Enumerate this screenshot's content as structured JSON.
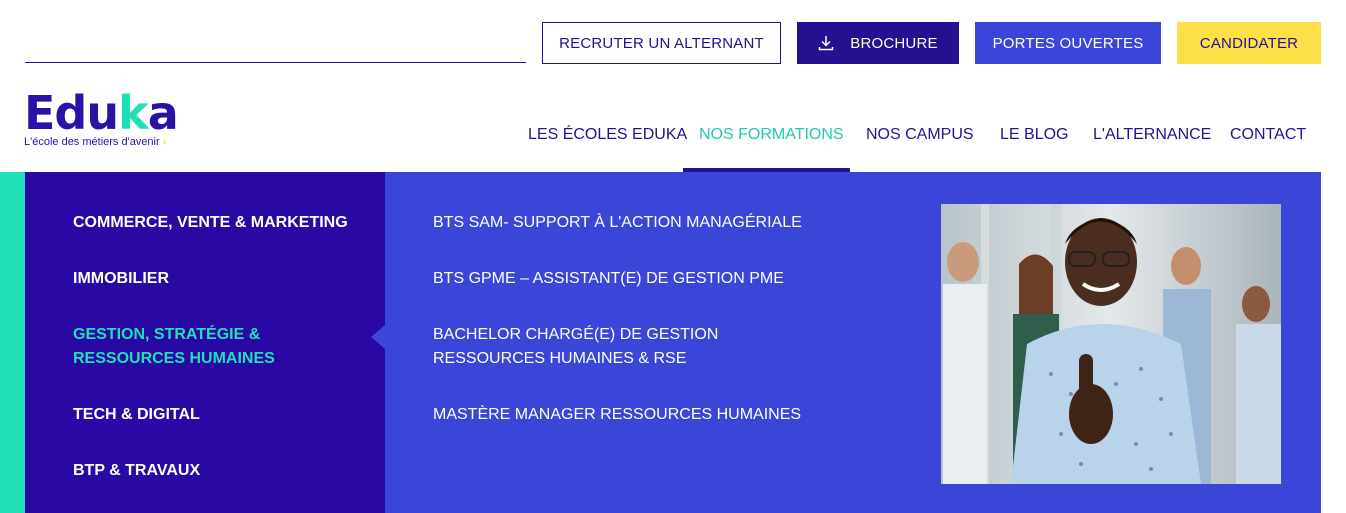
{
  "header": {
    "buttons": {
      "recruter": "RECRUTER UN ALTERNANT",
      "brochure": "BROCHURE",
      "portes": "PORTES OUVERTES",
      "candidater": "CANDIDATER"
    }
  },
  "logo": {
    "word_main": "Edu",
    "word_k": "k",
    "word_end": "a",
    "tagline": "L'école des métiers d'avenir",
    "tagline_chevron": "›"
  },
  "nav": {
    "items": [
      {
        "label": "LES ÉCOLES EDUKA"
      },
      {
        "label": "NOS FORMATIONS"
      },
      {
        "label": "NOS CAMPUS"
      },
      {
        "label": "LE BLOG"
      },
      {
        "label": "L'ALTERNANCE"
      },
      {
        "label": "CONTACT"
      }
    ],
    "active_index": 1
  },
  "menu": {
    "categories": [
      {
        "label": "COMMERCE, VENTE & MARKETING"
      },
      {
        "label": "IMMOBILIER"
      },
      {
        "label": "GESTION, STRATÉGIE & RESSOURCES HUMAINES"
      },
      {
        "label": "TECH & DIGITAL"
      },
      {
        "label": "BTP & TRAVAUX"
      }
    ],
    "active_category": 2,
    "formations": [
      {
        "label": "BTS SAM- SUPPORT À L'ACTION MANAGÉRIALE"
      },
      {
        "label": "BTS GPME – ASSISTANT(E) DE GESTION PME"
      },
      {
        "label": "BACHELOR CHARGÉ(E) DE GESTION RESSOURCES HUMAINES & RSE"
      },
      {
        "label": "MASTÈRE MANAGER RESSOURCES HUMAINES"
      }
    ]
  },
  "colors": {
    "brand_dark": "#25108f",
    "brand_blue": "#3b46d9",
    "accent_teal": "#1fe0b6",
    "accent_yellow": "#fde047"
  }
}
